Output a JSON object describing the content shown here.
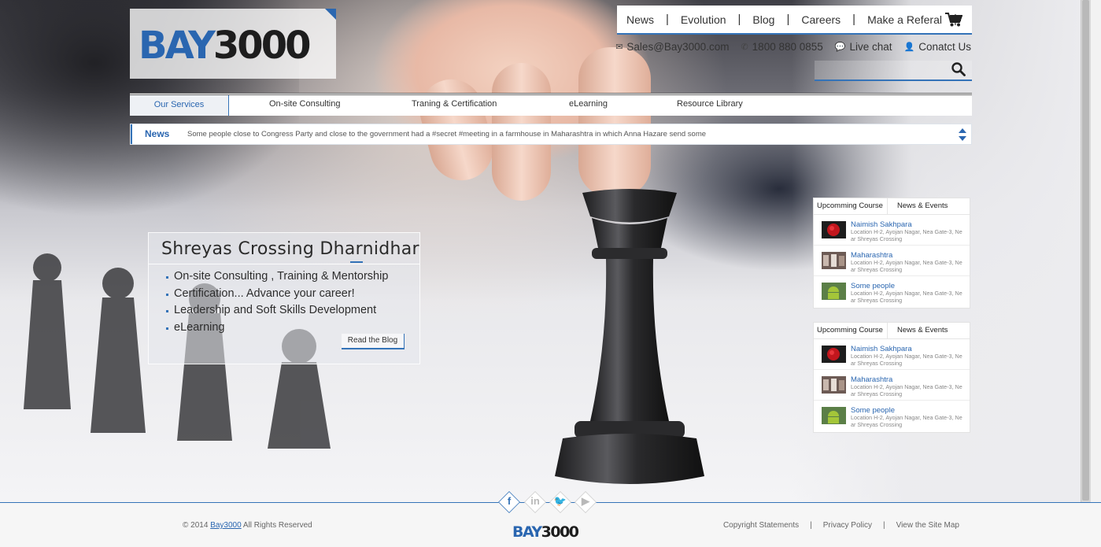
{
  "brand": {
    "logo_blue": "BAY",
    "logo_black": "3000",
    "accent_color": "#2a66b0"
  },
  "topnav": {
    "items": [
      "News",
      "Evolution",
      "Blog",
      "Careers",
      "Make a Referal"
    ],
    "cart_icon": "cart-icon"
  },
  "contact": {
    "email": "Sales@Bay3000.com",
    "phone": "1800 880 0855",
    "live_chat": "Live chat",
    "contact_us": "Conatct Us"
  },
  "search": {
    "placeholder": "",
    "icon": "search-icon"
  },
  "services": {
    "items": [
      "Our Services",
      "On-site Consulting",
      "Traning & Certification",
      "eLearning",
      "Resource Library"
    ]
  },
  "ticker": {
    "label": "News",
    "text": "Some people close to Congress Party and close to the government had a #secret #meeting in a farmhouse in Maharashtra in which Anna Hazare send some"
  },
  "feature": {
    "title": "Shreyas Crossing Dharnidhar",
    "bullets": [
      "On-site Consulting , Training & Mentorship",
      "Certification... Advance your career!",
      "Leadership and Soft Skills Development",
      "eLearning"
    ],
    "button": "Read the Blog"
  },
  "widgets": [
    {
      "tabs": [
        "Upcomming Course",
        "News & Events"
      ],
      "entries": [
        {
          "title": "Naimish Sakhpara",
          "location": "Location H-2, Ayojan Nagar, Nea Gate-3, Near Shreyas Crossing"
        },
        {
          "title": "Maharashtra",
          "location": "Location H-2, Ayojan Nagar, Nea Gate-3, Near Shreyas Crossing"
        },
        {
          "title": "Some people",
          "location": "Location H-2, Ayojan Nagar, Nea Gate-3, Near Shreyas Crossing"
        }
      ]
    },
    {
      "tabs": [
        "Upcomming Course",
        "News & Events"
      ],
      "entries": [
        {
          "title": "Naimish Sakhpara",
          "location": "Location H-2, Ayojan Nagar, Nea Gate-3, Near Shreyas Crossing"
        },
        {
          "title": "Maharashtra",
          "location": "Location H-2, Ayojan Nagar, Nea Gate-3, Near Shreyas Crossing"
        },
        {
          "title": "Some people",
          "location": "Location H-2, Ayojan Nagar, Nea Gate-3, Near Shreyas Crossing"
        }
      ]
    }
  ],
  "social": [
    "facebook-icon",
    "linkedin-icon",
    "twitter-icon",
    "youtube-icon"
  ],
  "footer": {
    "copyright_prefix": "© 2014",
    "copyright_link": "Bay3000",
    "copyright_suffix": "All Rights Reserved",
    "logo_blue": "BAY",
    "logo_black": "3000",
    "links": [
      "Copyright Statements",
      "Privacy Policy",
      "View the Site Map"
    ]
  }
}
